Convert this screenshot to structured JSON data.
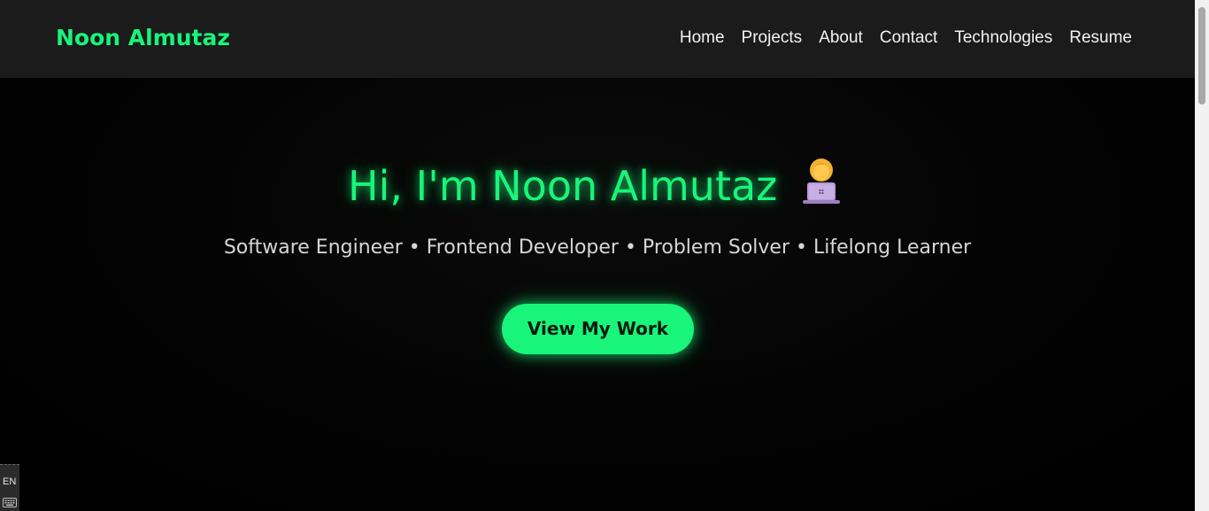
{
  "nav": {
    "brand": "Noon Almutaz",
    "links": [
      "Home",
      "Projects",
      "About",
      "Contact",
      "Technologies",
      "Resume"
    ]
  },
  "hero": {
    "title": "Hi, I'm Noon Almutaz",
    "title_icon": "woman-technologist-icon",
    "subtitle": "Software Engineer • Frontend Developer • Problem Solver • Lifelong Learner",
    "cta_label": "View My Work"
  },
  "language_indicator": {
    "label": "EN",
    "icon": "keyboard-icon"
  },
  "colors": {
    "accent": "#18f57a",
    "navbar_bg": "#1b1b1b",
    "page_bg": "#000000",
    "text": "#f2f2f2",
    "subtitle_text": "#d6d6d6"
  }
}
